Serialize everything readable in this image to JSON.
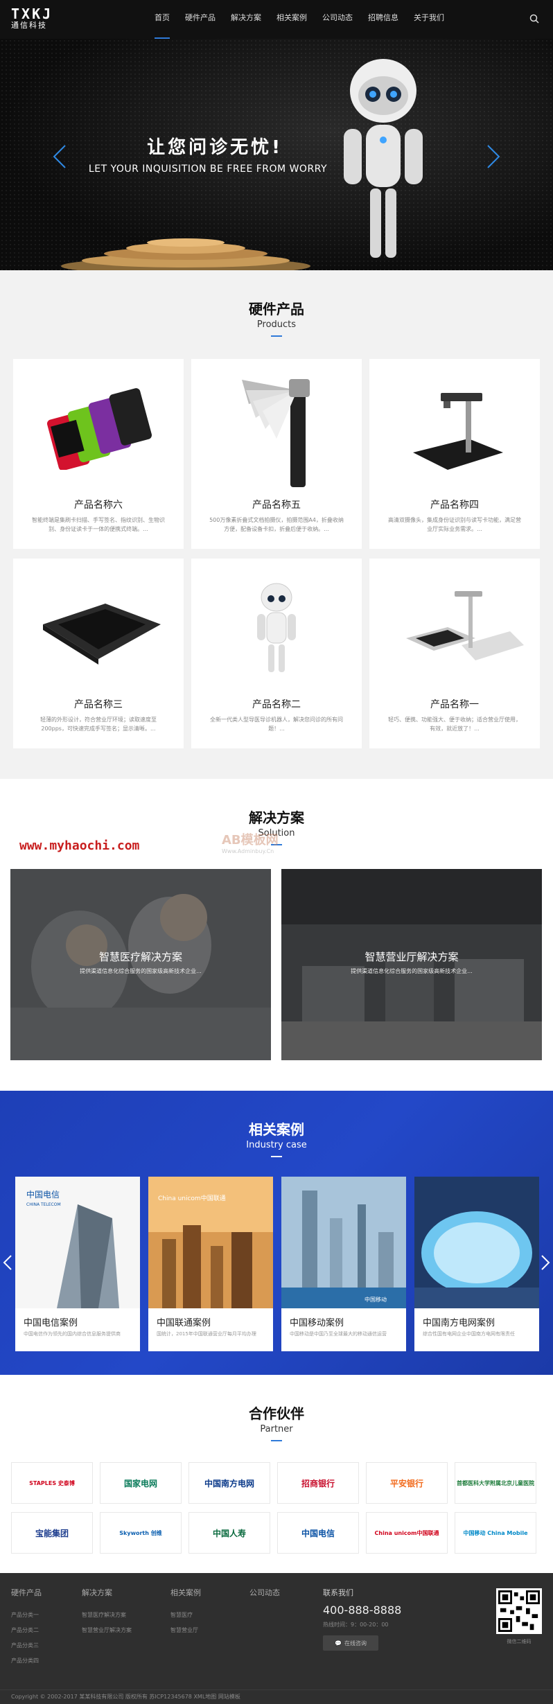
{
  "header": {
    "logo_top": "TXKJ",
    "logo_bottom": "通信科技",
    "nav": [
      {
        "label": "首页",
        "active": true
      },
      {
        "label": "硬件产品"
      },
      {
        "label": "解决方案"
      },
      {
        "label": "相关案例"
      },
      {
        "label": "公司动态"
      },
      {
        "label": "招聘信息"
      },
      {
        "label": "关于我们"
      }
    ],
    "search_icon": "search-icon"
  },
  "hero": {
    "title": "让您问诊无忧!",
    "subtitle": "LET YOUR INQUISITION BE FREE FROM WORRY"
  },
  "products": {
    "title_cn": "硬件产品",
    "title_en": "Products",
    "items": [
      {
        "name": "产品名称六",
        "desc": "智能终端是集刷卡扫描、手写签名、指纹识别、生物识别、身份证读卡于一体的便携式终端。..."
      },
      {
        "name": "产品名称五",
        "desc": "500万像素折叠式文档拍摄仪，拍摄范围A4，折叠收纳方便，配备设备卡扣，折叠后便于收纳。..."
      },
      {
        "name": "产品名称四",
        "desc": "高清双摄像头，集成身份证识别与读写卡功能，满足营业厅实际业务需求。..."
      },
      {
        "name": "产品名称三",
        "desc": "轻薄的外形设计，符合营业厅环境；读取速度至200pps，可快速完成手写签名；显示清晰。..."
      },
      {
        "name": "产品名称二",
        "desc": "全新一代类人型导医导诊机器人，解决您问诊的所有问题！..."
      },
      {
        "name": "产品名称一",
        "desc": "轻巧、便携、功能强大、便于收纳；适合营业厅使用，有效，就近放了！..."
      }
    ]
  },
  "solutions": {
    "title_cn": "解决方案",
    "title_en": "Solution",
    "watermark_red": "www.myhaochi.com",
    "watermark_ab": "AB模板网",
    "watermark_ab_url": "Www.Adminbuy.Cn",
    "items": [
      {
        "name": "智慧医疗解决方案",
        "desc": "提供渠道信息化综合服务的国家级高新技术企业..."
      },
      {
        "name": "智慧营业厅解决方案",
        "desc": "提供渠道信息化综合服务的国家级高新技术企业..."
      }
    ]
  },
  "cases": {
    "title_cn": "相关案例",
    "title_en": "Industry case",
    "items": [
      {
        "name": "中国电信案例",
        "desc": "中国电信作为领先的国内综合信息服务提供商"
      },
      {
        "name": "中国联通案例",
        "desc": "国统计，2015年中国联通营业厅每月平均办理"
      },
      {
        "name": "中国移动案例",
        "desc": "中国移动是中国乃至全球最大的移动通信运营"
      },
      {
        "name": "中国南方电网案例",
        "desc": "综合性国有电网企业中国南方电网有限责任"
      }
    ],
    "logos": [
      "中国电信",
      "CHINA TELECOM",
      "China unicom中国联通",
      "中国移动"
    ]
  },
  "partners": {
    "title_cn": "合作伙伴",
    "title_en": "Partner",
    "items": [
      {
        "label": "STAPLES 史泰博",
        "color": "#d0021b"
      },
      {
        "label": "国家电网",
        "color": "#0a7b5a"
      },
      {
        "label": "中国南方电网",
        "color": "#0b3a8a"
      },
      {
        "label": "招商银行",
        "color": "#c8102e"
      },
      {
        "label": "平安银行",
        "color": "#f26b1d"
      },
      {
        "label": "首都医科大学附属北京儿童医院",
        "color": "#1f7d3c"
      },
      {
        "label": "宝能集团",
        "color": "#1d3d8e"
      },
      {
        "label": "Skyworth 创维",
        "color": "#0b5fb0"
      },
      {
        "label": "中国人寿",
        "color": "#0b6b3f"
      },
      {
        "label": "中国电信",
        "color": "#0b53a5"
      },
      {
        "label": "China unicom中国联通",
        "color": "#d0021b"
      },
      {
        "label": "中国移动 China Mobile",
        "color": "#0089c8"
      }
    ]
  },
  "footer": {
    "cols": [
      {
        "title": "硬件产品",
        "items": [
          "产品分类一",
          "产品分类二",
          "产品分类三",
          "产品分类四"
        ]
      },
      {
        "title": "解决方案",
        "items": [
          "智慧医疗解决方案",
          "智慧营业厅解决方案"
        ]
      },
      {
        "title": "相关案例",
        "items": [
          "智慧医疗",
          "智慧营业厅"
        ]
      },
      {
        "title": "公司动态",
        "items": []
      }
    ],
    "contact_title": "联系我们",
    "phone": "400-888-8888",
    "hours": "热线时间：9：00-20：00",
    "consult": "在线咨询",
    "qr_label": "微信二维码",
    "copyright": "Copyright © 2002-2017 某某科技有限公司 版权所有  苏ICP12345678  XML地图  网站模板"
  },
  "colors": {
    "accent": "#2f7ad9",
    "header_bg": "#111111",
    "cases_bg": "#2348c8",
    "footer_bg": "#2f2f2f"
  }
}
